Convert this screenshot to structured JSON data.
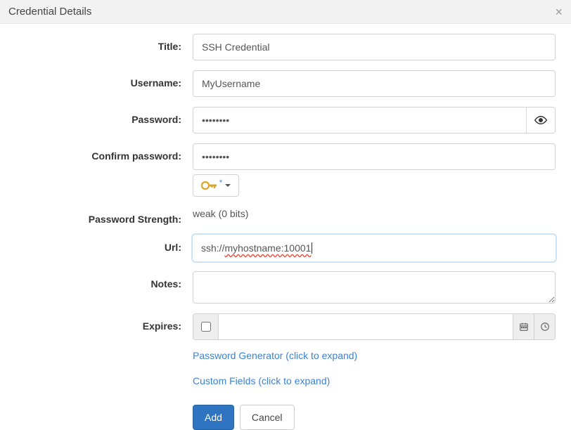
{
  "header": {
    "title": "Credential Details"
  },
  "labels": {
    "title": "Title:",
    "username": "Username:",
    "password": "Password:",
    "confirm": "Confirm password:",
    "strength": "Password Strength:",
    "url": "Url:",
    "notes": "Notes:",
    "expires": "Expires:"
  },
  "fields": {
    "title": "SSH Credential",
    "username": "MyUsername",
    "password": "••••••••",
    "confirm": "••••••••",
    "url_prefix": "ssh://",
    "url_wavy": "myhostname:10001",
    "notes": "",
    "expires": ""
  },
  "strength": "weak (0 bits)",
  "links": {
    "pwgen": "Password Generator (click to expand)",
    "custom": "Custom Fields (click to expand)"
  },
  "buttons": {
    "add": "Add",
    "cancel": "Cancel"
  }
}
